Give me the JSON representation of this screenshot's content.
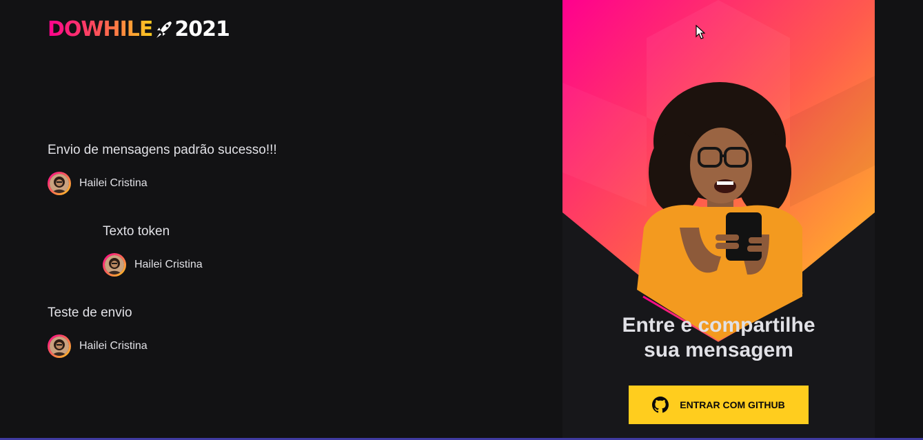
{
  "logo": {
    "word": "DOWHILE",
    "year": "2021",
    "rocket_icon": "rocket-icon"
  },
  "messages": [
    {
      "content": "Envio de mensagens padrão sucesso!!!",
      "user_name": "Hailei Cristina"
    },
    {
      "content": "Texto token",
      "user_name": "Hailei Cristina"
    },
    {
      "content": "Teste de envio",
      "user_name": "Hailei Cristina"
    }
  ],
  "login": {
    "title_line1": "Entre e compartilhe",
    "title_line2": "sua mensagem",
    "button_label": "ENTRAR COM GITHUB",
    "button_icon": "github-icon"
  },
  "colors": {
    "background": "#121214",
    "accent_yellow": "#ffcd1e",
    "gradient_pink": "#ff008e",
    "gradient_orange": "#ffcd1e",
    "text": "#e1e1e6"
  }
}
